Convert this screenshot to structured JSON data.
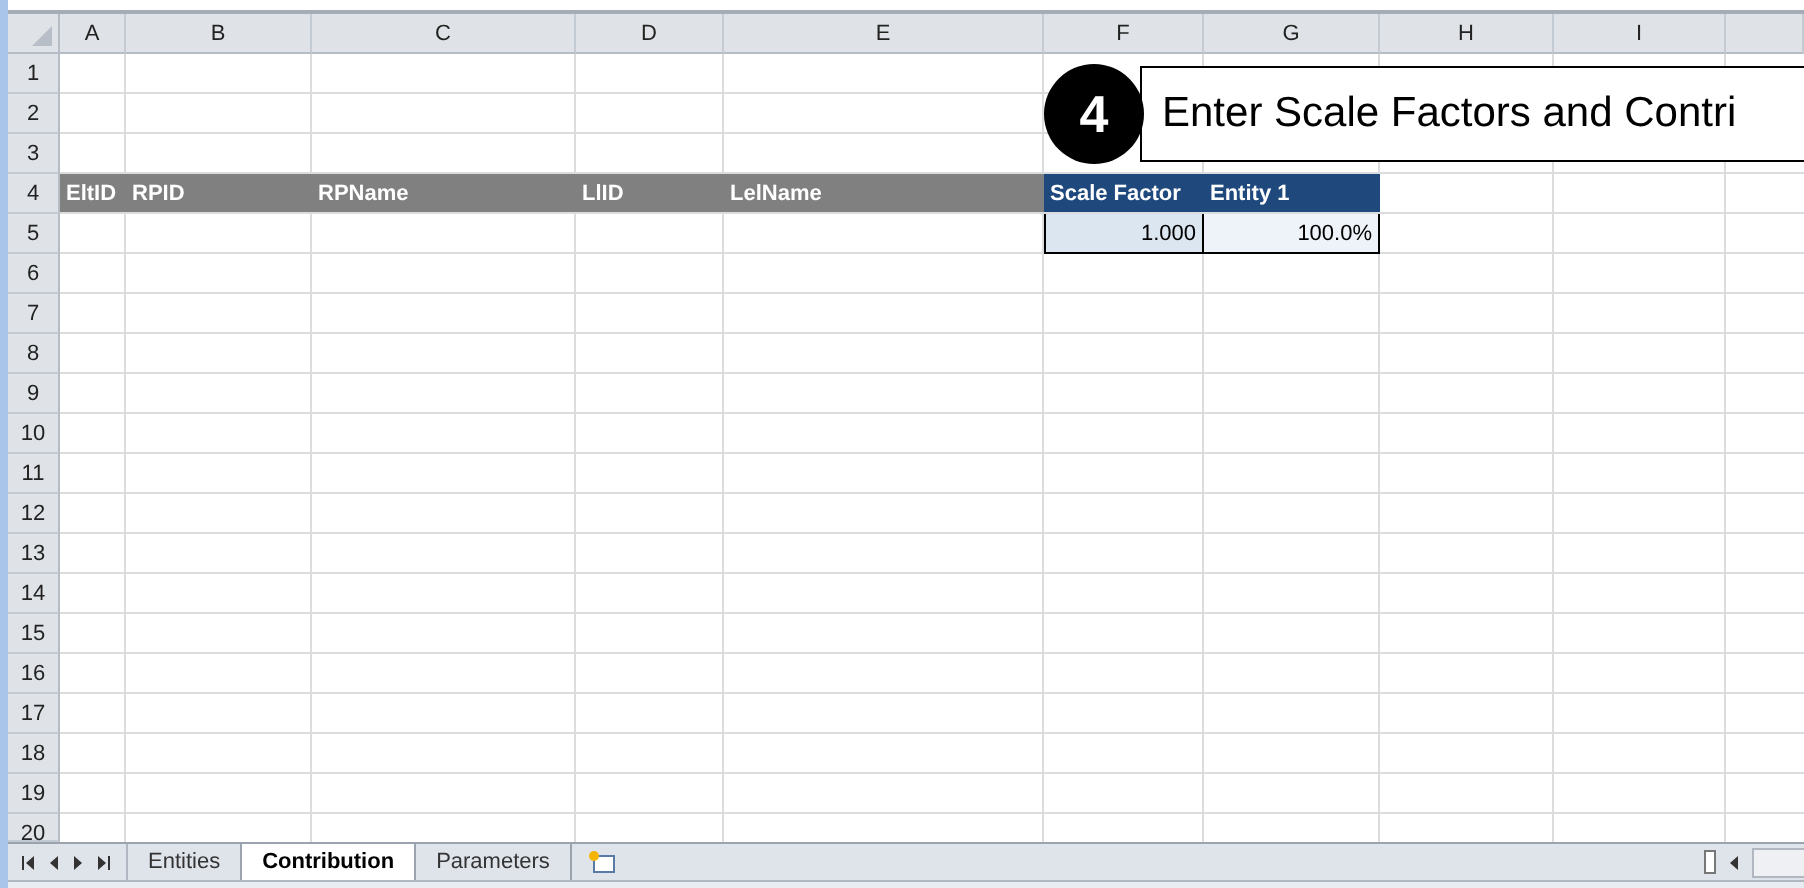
{
  "columns": [
    "A",
    "B",
    "C",
    "D",
    "E",
    "F",
    "G",
    "H",
    "I"
  ],
  "row_numbers": [
    "1",
    "2",
    "3",
    "4",
    "5",
    "6",
    "7",
    "8",
    "9",
    "10",
    "11",
    "12",
    "13",
    "14",
    "15",
    "16",
    "17",
    "18",
    "19",
    "20"
  ],
  "step": {
    "number": "4",
    "title": "Enter Scale Factors and Contri"
  },
  "header_row": [
    {
      "text": "EltID",
      "kind": "label"
    },
    {
      "text": "RPID",
      "kind": "label"
    },
    {
      "text": "RPName",
      "kind": "label"
    },
    {
      "text": "LlID",
      "kind": "label"
    },
    {
      "text": "LelName",
      "kind": "label"
    },
    {
      "text": "Scale Factor",
      "kind": "input"
    },
    {
      "text": "Entity 1",
      "kind": "input"
    }
  ],
  "value_row": [
    {
      "text": "1.000",
      "kind": "factor"
    },
    {
      "text": "100.0%",
      "kind": "share"
    }
  ],
  "sheet_tabs": [
    {
      "label": "Entities",
      "selected": false
    },
    {
      "label": "Contribution",
      "selected": true
    },
    {
      "label": "Parameters",
      "selected": false
    }
  ]
}
